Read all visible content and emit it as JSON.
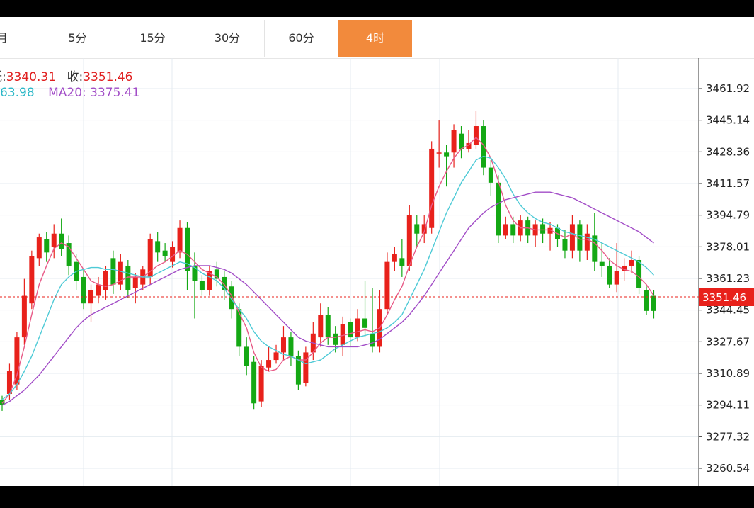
{
  "tabs": [
    {
      "label": "月",
      "active": false
    },
    {
      "label": "5分",
      "active": false
    },
    {
      "label": "15分",
      "active": false
    },
    {
      "label": "30分",
      "active": false
    },
    {
      "label": "60分",
      "active": false
    },
    {
      "label": "4时",
      "active": true
    }
  ],
  "info": {
    "low_label": "低:",
    "low_value": "3340.31",
    "close_label": "收:",
    "close_value": "3351.46",
    "ma_partial_value": "63.98",
    "ma20_label": "MA20:",
    "ma20_value": "3375.41"
  },
  "colors": {
    "up": "#e8211b",
    "down": "#14a814",
    "ma5": "#e85a87",
    "ma10": "#4dcad6",
    "ma20": "#a24dc7",
    "accent": "#f28a3c",
    "grid": "#e4ebf0"
  },
  "chart_data": {
    "type": "candlestick",
    "y_ticks": [
      "3461.92",
      "3445.14",
      "3428.36",
      "3411.57",
      "3394.79",
      "3378.01",
      "3361.23",
      "3344.45",
      "3327.67",
      "3310.89",
      "3294.11",
      "3277.32",
      "3260.54"
    ],
    "current_price": "3351.46",
    "ylim": [
      3255,
      3475
    ],
    "candles": [
      [
        3297,
        3294,
        3299,
        3291
      ],
      [
        3300,
        3312,
        3316,
        3297
      ],
      [
        3305,
        3330,
        3333,
        3302
      ],
      [
        3330,
        3352,
        3361,
        3326
      ],
      [
        3348,
        3373,
        3376,
        3345
      ],
      [
        3372,
        3383,
        3385,
        3368
      ],
      [
        3382,
        3375,
        3386,
        3370
      ],
      [
        3378,
        3385,
        3390,
        3372
      ],
      [
        3385,
        3377,
        3393,
        3373
      ],
      [
        3380,
        3368,
        3384,
        3363
      ],
      [
        3370,
        3360,
        3374,
        3355
      ],
      [
        3362,
        3348,
        3366,
        3345
      ],
      [
        3348,
        3355,
        3358,
        3338
      ],
      [
        3352,
        3358,
        3362,
        3348
      ],
      [
        3355,
        3365,
        3368,
        3350
      ],
      [
        3372,
        3358,
        3376,
        3353
      ],
      [
        3358,
        3370,
        3374,
        3355
      ],
      [
        3368,
        3355,
        3371,
        3351
      ],
      [
        3356,
        3362,
        3364,
        3348
      ],
      [
        3358,
        3366,
        3368,
        3355
      ],
      [
        3362,
        3382,
        3385,
        3358
      ],
      [
        3381,
        3375,
        3386,
        3370
      ],
      [
        3376,
        3373,
        3380,
        3370
      ],
      [
        3370,
        3378,
        3381,
        3367
      ],
      [
        3375,
        3388,
        3392,
        3372
      ],
      [
        3388,
        3365,
        3391,
        3355
      ],
      [
        3368,
        3360,
        3375,
        3340
      ],
      [
        3360,
        3355,
        3363,
        3352
      ],
      [
        3355,
        3365,
        3368,
        3352
      ],
      [
        3366,
        3361,
        3370,
        3357
      ],
      [
        3362,
        3355,
        3365,
        3350
      ],
      [
        3357,
        3345,
        3360,
        3340
      ],
      [
        3345,
        3325,
        3348,
        3320
      ],
      [
        3325,
        3315,
        3330,
        3310
      ],
      [
        3317,
        3295,
        3320,
        3292
      ],
      [
        3296,
        3315,
        3318,
        3293
      ],
      [
        3314,
        3318,
        3325,
        3312
      ],
      [
        3318,
        3322,
        3326,
        3316
      ],
      [
        3322,
        3330,
        3336,
        3318
      ],
      [
        3330,
        3320,
        3333,
        3315
      ],
      [
        3320,
        3305,
        3323,
        3302
      ],
      [
        3306,
        3322,
        3325,
        3304
      ],
      [
        3322,
        3332,
        3338,
        3318
      ],
      [
        3330,
        3342,
        3348,
        3325
      ],
      [
        3342,
        3330,
        3346,
        3326
      ],
      [
        3332,
        3326,
        3336,
        3322
      ],
      [
        3326,
        3337,
        3341,
        3320
      ],
      [
        3338,
        3330,
        3340,
        3325
      ],
      [
        3330,
        3340,
        3345,
        3328
      ],
      [
        3340,
        3335,
        3360,
        3330
      ],
      [
        3332,
        3325,
        3356,
        3322
      ],
      [
        3325,
        3345,
        3355,
        3322
      ],
      [
        3345,
        3370,
        3375,
        3342
      ],
      [
        3370,
        3374,
        3378,
        3365
      ],
      [
        3372,
        3368,
        3382,
        3362
      ],
      [
        3368,
        3395,
        3400,
        3365
      ],
      [
        3390,
        3385,
        3395,
        3378
      ],
      [
        3385,
        3390,
        3395,
        3380
      ],
      [
        3388,
        3430,
        3434,
        3385
      ],
      [
        3428,
        3428,
        3445,
        3420
      ],
      [
        3428,
        3426,
        3432,
        3410
      ],
      [
        3428,
        3440,
        3443,
        3420
      ],
      [
        3438,
        3430,
        3442,
        3425
      ],
      [
        3430,
        3433,
        3440,
        3428
      ],
      [
        3432,
        3442,
        3450,
        3430
      ],
      [
        3442,
        3420,
        3445,
        3416
      ],
      [
        3420,
        3412,
        3424,
        3405
      ],
      [
        3412,
        3384,
        3416,
        3380
      ],
      [
        3384,
        3390,
        3394,
        3382
      ],
      [
        3390,
        3384,
        3394,
        3380
      ],
      [
        3384,
        3392,
        3395,
        3381
      ],
      [
        3392,
        3384,
        3394,
        3380
      ],
      [
        3384,
        3390,
        3392,
        3378
      ],
      [
        3390,
        3385,
        3393,
        3380
      ],
      [
        3385,
        3388,
        3391,
        3376
      ],
      [
        3388,
        3382,
        3390,
        3378
      ],
      [
        3382,
        3376,
        3387,
        3372
      ],
      [
        3376,
        3390,
        3395,
        3372
      ],
      [
        3390,
        3376,
        3392,
        3370
      ],
      [
        3376,
        3385,
        3390,
        3371
      ],
      [
        3384,
        3370,
        3396,
        3365
      ],
      [
        3370,
        3368,
        3380,
        3362
      ],
      [
        3368,
        3358,
        3372,
        3356
      ],
      [
        3358,
        3365,
        3380,
        3354
      ],
      [
        3365,
        3368,
        3372,
        3360
      ],
      [
        3368,
        3371,
        3376,
        3364
      ],
      [
        3371,
        3356,
        3373,
        3353
      ],
      [
        3355,
        3344,
        3357,
        3342
      ],
      [
        3352,
        3344,
        3355,
        3340
      ]
    ],
    "ma_lines": [
      {
        "key": "ma5",
        "values": [
          3295,
          3300,
          3310,
          3325,
          3342,
          3358,
          3368,
          3377,
          3380,
          3378,
          3372,
          3366,
          3360,
          3358,
          3357,
          3358,
          3360,
          3362,
          3362,
          3362,
          3365,
          3368,
          3370,
          3373,
          3376,
          3374,
          3370,
          3366,
          3364,
          3362,
          3358,
          3352,
          3343,
          3335,
          3322,
          3314,
          3312,
          3313,
          3318,
          3320,
          3318,
          3318,
          3322,
          3327,
          3330,
          3330,
          3331,
          3332,
          3333,
          3334,
          3333,
          3335,
          3342,
          3350,
          3357,
          3368,
          3378,
          3386,
          3400,
          3410,
          3418,
          3425,
          3430,
          3432,
          3436,
          3432,
          3425,
          3413,
          3400,
          3392,
          3388,
          3388,
          3387,
          3387,
          3387,
          3385,
          3383,
          3385,
          3382,
          3382,
          3380,
          3376,
          3371,
          3368,
          3366,
          3365,
          3362,
          3358,
          3352
        ]
      },
      {
        "key": "ma10",
        "values": [
          3297,
          3300,
          3305,
          3312,
          3320,
          3330,
          3340,
          3350,
          3358,
          3362,
          3365,
          3366,
          3367,
          3367,
          3366,
          3366,
          3365,
          3364,
          3363,
          3362,
          3362,
          3364,
          3366,
          3368,
          3370,
          3369,
          3367,
          3364,
          3362,
          3360,
          3356,
          3350,
          3345,
          3340,
          3333,
          3328,
          3325,
          3323,
          3321,
          3320,
          3318,
          3316,
          3317,
          3318,
          3321,
          3324,
          3326,
          3328,
          3330,
          3331,
          3332,
          3333,
          3335,
          3338,
          3342,
          3350,
          3358,
          3366,
          3376,
          3386,
          3396,
          3404,
          3412,
          3418,
          3424,
          3426,
          3425,
          3420,
          3414,
          3406,
          3400,
          3396,
          3393,
          3391,
          3390,
          3388,
          3386,
          3385,
          3384,
          3383,
          3382,
          3380,
          3378,
          3376,
          3374,
          3372,
          3370,
          3367,
          3363
        ]
      },
      {
        "key": "ma20",
        "values": [
          3294,
          3296,
          3299,
          3302,
          3306,
          3310,
          3315,
          3320,
          3325,
          3330,
          3335,
          3339,
          3342,
          3344,
          3346,
          3348,
          3350,
          3352,
          3354,
          3356,
          3358,
          3360,
          3362,
          3364,
          3366,
          3367,
          3368,
          3368,
          3368,
          3367,
          3366,
          3364,
          3361,
          3358,
          3354,
          3350,
          3346,
          3342,
          3338,
          3334,
          3330,
          3328,
          3327,
          3326,
          3325,
          3325,
          3325,
          3325,
          3325,
          3326,
          3327,
          3329,
          3332,
          3335,
          3338,
          3342,
          3347,
          3352,
          3358,
          3364,
          3370,
          3376,
          3382,
          3388,
          3392,
          3396,
          3399,
          3401,
          3403,
          3404,
          3405,
          3406,
          3407,
          3407,
          3407,
          3406,
          3405,
          3404,
          3402,
          3400,
          3398,
          3396,
          3394,
          3392,
          3390,
          3388,
          3386,
          3383,
          3380
        ]
      }
    ]
  }
}
